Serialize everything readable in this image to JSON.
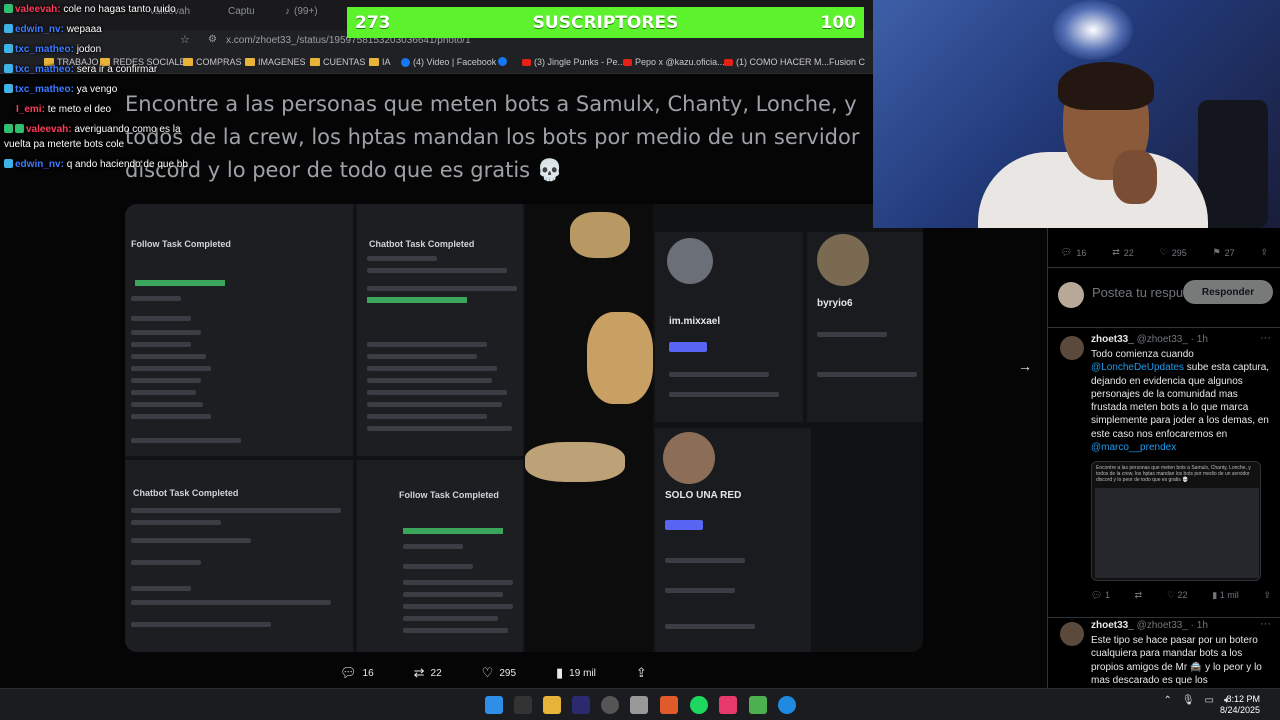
{
  "browser": {
    "tabs": [
      "valeevah",
      "Captu",
      "(99+)"
    ],
    "address": "x.com/zhoet33_/status/1959758153203036641/photo/1",
    "bookmarks": [
      "TRABAJO",
      "REDES SOCIALES",
      "COMPRAS",
      "IMAGENES",
      "CUENTAS",
      "IA",
      "(4) Video | Facebook",
      "(3) Jingle Punks - Pe...",
      "Pepo x @kazu.oficia...",
      "(1) COMO HACER M...",
      "Fusion C"
    ]
  },
  "tweet": {
    "text": "Encontre a las personas que meten bots a Samulx, Chanty, Lonche, y todos de la crew, los hptas mandan los bots por medio de un servidor discord y lo peor de todo que es gratis 💀",
    "actions": {
      "replies": "16",
      "reposts": "22",
      "likes": "295",
      "views": "19 mil"
    }
  },
  "photo": {
    "panel1_title": "Follow Task Completed",
    "panel2_title": "Chatbot Task Completed",
    "panel3_title": "Chatbot Task Completed",
    "panel4_title": "Follow Task Completed",
    "profile1": "im.mixxael",
    "profile2": "byryio6",
    "profile3": "SOLO UNA RED"
  },
  "sidebar": {
    "stats": {
      "replies": "16",
      "reposts": "22",
      "likes": "295",
      "bookmarks": "27"
    },
    "reply_placeholder": "Postea tu respuesta",
    "reply_button": "Responder",
    "replies": [
      {
        "name": "zhoet33_",
        "handle": "@zhoet33_ · 1h",
        "body_pre": "Todo comienza cuando ",
        "mention1": "@LoncheDeUpdates",
        "body_mid": " sube esta captura, dejando en evidencia que algunos personajes de la comunidad mas frustada meten bots a lo que marca simplemente para joder a los demas, en este caso nos enfocaremos en ",
        "mention2": "@marco__prendex",
        "stats": {
          "replies": "1",
          "likes": "22",
          "views": "1 mil"
        }
      },
      {
        "name": "zhoet33_",
        "handle": "@zhoet33_ · 1h",
        "body": "Este tipo se hace pasar por un botero cualquiera para mandar bots a los propios amigos de Mr 🚔 y lo peor y lo mas descarado es que los"
      }
    ]
  },
  "chat": [
    {
      "user": "valeevah:",
      "msg": "cole no hagas tanto ruido",
      "color": "#ff3b5c",
      "badge": "g"
    },
    {
      "user": "edwin_nv:",
      "msg": "wepaaa",
      "color": "#3d7bff",
      "badge": "b"
    },
    {
      "user": "txc_matheo:",
      "msg": "jodon",
      "color": "#3d7bff",
      "badge": "b"
    },
    {
      "user": "txc_matheo:",
      "msg": "sera ir a confirmar",
      "color": "#3d7bff",
      "badge": "b"
    },
    {
      "user": "txc_matheo:",
      "msg": "ya vengo",
      "color": "#3d7bff",
      "badge": "b"
    },
    {
      "user": "I_emi:",
      "msg": "te meto el deo",
      "color": "#ff3b5c",
      "badge": ""
    },
    {
      "user": "valeevah:",
      "msg": "averiguando como es la",
      "color": "#ff3b5c",
      "badge": "g"
    },
    {
      "user": "",
      "msg": "vuelta pa meterte bots cole",
      "color": "#ffffff",
      "badge": ""
    },
    {
      "user": "edwin_nv:",
      "msg": "q ando haciendo de que bb",
      "color": "#3d7bff",
      "badge": "b"
    }
  ],
  "subgoal": {
    "current": "273",
    "label": "SUSCRIPTORES",
    "target": "100"
  },
  "taskbar": {
    "time": "8:12 PM",
    "date": "8/24/2025"
  }
}
